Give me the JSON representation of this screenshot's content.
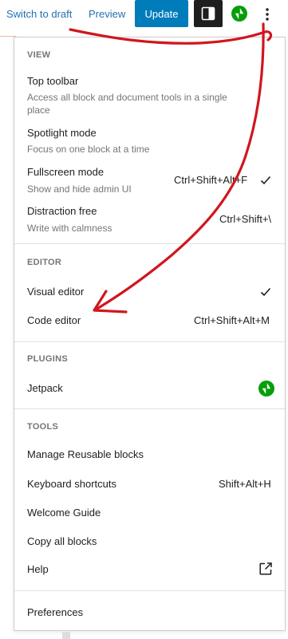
{
  "toolbar": {
    "switch_to_draft": "Switch to draft",
    "preview": "Preview",
    "update": "Update"
  },
  "icons": {
    "sidebar_toggle": "sidebar-panel-icon",
    "jetpack": "jetpack-icon",
    "more": "vertical-ellipsis-icon",
    "check": "checkmark-icon",
    "external": "external-link-icon"
  },
  "colors": {
    "primary": "#007cba",
    "link": "#2271b1",
    "dark": "#1e1e1e",
    "jetpack": "#069e08",
    "annotation": "#d0161e"
  },
  "menu": {
    "view": {
      "heading": "VIEW",
      "items": [
        {
          "label": "Top toolbar",
          "desc": "Access all block and document tools in a single place"
        },
        {
          "label": "Spotlight mode",
          "desc": "Focus on one block at a time"
        },
        {
          "label": "Fullscreen mode",
          "desc": "Show and hide admin UI",
          "shortcut": "Ctrl+Shift+Alt+F",
          "checked": true
        },
        {
          "label": "Distraction free",
          "desc": "Write with calmness",
          "shortcut": "Ctrl+Shift+\\"
        }
      ]
    },
    "editor": {
      "heading": "EDITOR",
      "items": [
        {
          "label": "Visual editor",
          "checked": true
        },
        {
          "label": "Code editor",
          "shortcut": "Ctrl+Shift+Alt+M"
        }
      ]
    },
    "plugins": {
      "heading": "PLUGINS",
      "items": [
        {
          "label": "Jetpack"
        }
      ]
    },
    "tools": {
      "heading": "TOOLS",
      "items": [
        {
          "label": "Manage Reusable blocks"
        },
        {
          "label": "Keyboard shortcuts",
          "shortcut": "Shift+Alt+H"
        },
        {
          "label": "Welcome Guide"
        },
        {
          "label": "Copy all blocks"
        },
        {
          "label": "Help"
        }
      ]
    },
    "preferences": "Preferences"
  }
}
